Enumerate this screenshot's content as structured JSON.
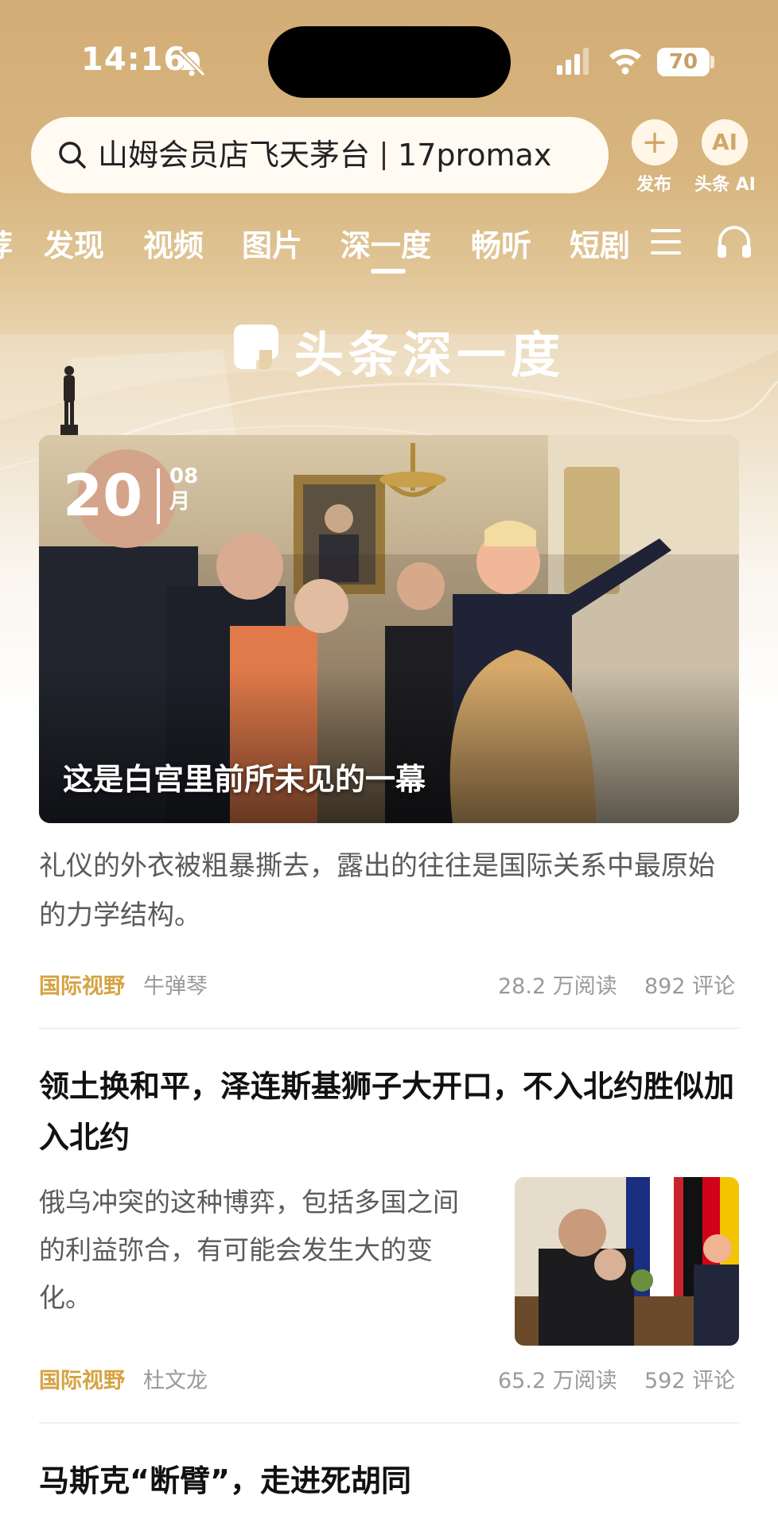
{
  "status": {
    "time": "14:16",
    "battery": "70"
  },
  "search": {
    "text_left": "山姆会员店飞天茅台",
    "text_right": "17promax"
  },
  "actions": [
    {
      "icon": "+",
      "label": "发布"
    },
    {
      "icon": "AI",
      "label": "头条 AI"
    }
  ],
  "tabs": [
    {
      "label": "荐"
    },
    {
      "label": "发现"
    },
    {
      "label": "视频"
    },
    {
      "label": "图片"
    },
    {
      "label": "深一度"
    },
    {
      "label": "畅听"
    },
    {
      "label": "短剧"
    }
  ],
  "banner": {
    "title": "头条深一度"
  },
  "hero": {
    "date_day": "20",
    "date_month_num": "08",
    "date_month_unit": "月",
    "title": "这是白宫里前所未见的一幕"
  },
  "articles": [
    {
      "summary": "礼仪的外衣被粗暴撕去，露出的往往是国际关系中最原始的力学结构。",
      "category": "国际视野",
      "author": "牛弹琴",
      "reads": "28.2 万阅读",
      "comments": "892 评论"
    },
    {
      "title": "领土换和平，泽连斯基狮子大开口，不入北约胜似加入北约",
      "summary": "俄乌冲突的这种博弈，包括多国之间的利益弥合，有可能会发生大的变化。",
      "category": "国际视野",
      "author": "杜文龙",
      "reads": "65.2 万阅读",
      "comments": "592 评论"
    },
    {
      "title": "马斯克“断臂”，走进死胡同"
    }
  ],
  "colors": {
    "accent": "#d6a342",
    "header": "#d3ad76"
  }
}
